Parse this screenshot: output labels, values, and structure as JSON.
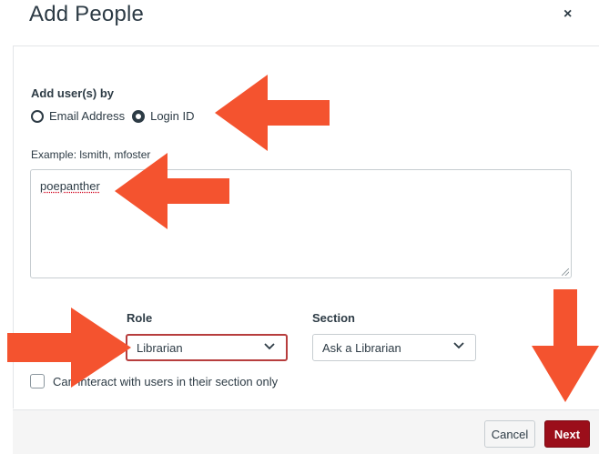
{
  "dialog": {
    "title": "Add People",
    "close_symbol": "×"
  },
  "add_by": {
    "label": "Add user(s) by",
    "options": [
      {
        "label": "Email Address",
        "selected": false
      },
      {
        "label": "Login ID",
        "selected": true
      }
    ]
  },
  "input": {
    "example_text": "Example: lsmith, mfoster",
    "value": "poepanther"
  },
  "role": {
    "label": "Role",
    "selected": "Librarian"
  },
  "section": {
    "label": "Section",
    "selected": "Ask a Librarian"
  },
  "limit_checkbox": {
    "label": "Can interact with users in their section only",
    "checked": false
  },
  "footer": {
    "cancel_label": "Cancel",
    "next_label": "Next"
  },
  "annotation": {
    "arrow_color": "#f4532f",
    "accent_color": "#9b0e1a",
    "icon": "arrow-icon"
  }
}
